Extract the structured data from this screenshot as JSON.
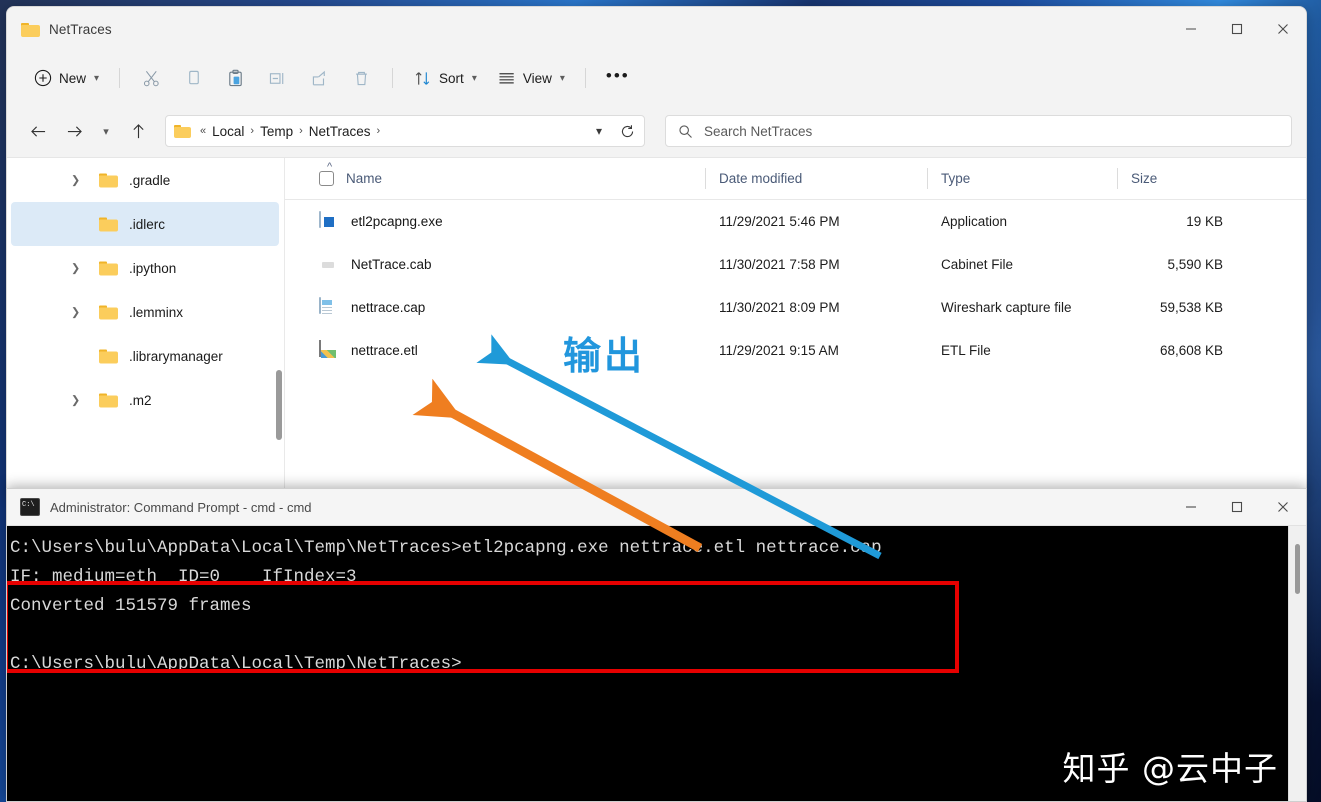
{
  "window": {
    "title": "NetTraces",
    "controls": {
      "minimize": "minimize-icon",
      "maximize": "maximize-icon",
      "close": "close-icon"
    }
  },
  "toolbar": {
    "new_label": "New",
    "cut_icon": "scissors-icon",
    "copy_icon": "copy-icon",
    "paste_icon": "paste-icon",
    "rename_icon": "rename-icon",
    "share_icon": "share-icon",
    "delete_icon": "trash-icon",
    "sort_label": "Sort",
    "view_label": "View",
    "overflow_label": "•••"
  },
  "nav": {
    "back_icon": "back-arrow-icon",
    "forward_icon": "forward-arrow-icon",
    "recent_icon": "chevron-down-icon",
    "up_icon": "up-arrow-icon",
    "refresh_icon": "refresh-icon",
    "breadcrumb_prefix": "«",
    "breadcrumbs": [
      "Local",
      "Temp",
      "NetTraces"
    ],
    "separator": "›"
  },
  "search": {
    "placeholder": "Search NetTraces",
    "icon": "search-icon"
  },
  "sidebar": {
    "items": [
      {
        "label": ".gradle",
        "expandable": true,
        "selected": false
      },
      {
        "label": ".idlerc",
        "expandable": false,
        "selected": true
      },
      {
        "label": ".ipython",
        "expandable": true,
        "selected": false
      },
      {
        "label": ".lemminx",
        "expandable": true,
        "selected": false
      },
      {
        "label": ".librarymanager",
        "expandable": false,
        "selected": false
      },
      {
        "label": ".m2",
        "expandable": true,
        "selected": false
      }
    ]
  },
  "filelist": {
    "columns": {
      "name": "Name",
      "date_modified": "Date modified",
      "type": "Type",
      "size": "Size"
    },
    "sort_indicator": "^",
    "rows": [
      {
        "name": "etl2pcapng.exe",
        "date_modified": "11/29/2021 5:46 PM",
        "type": "Application",
        "size": "19 KB",
        "icon": "application-exe-icon"
      },
      {
        "name": "NetTrace.cab",
        "date_modified": "11/30/2021 7:58 PM",
        "type": "Cabinet File",
        "size": "5,590 KB",
        "icon": "cabinet-file-icon"
      },
      {
        "name": "nettrace.cap",
        "date_modified": "11/30/2021 8:09 PM",
        "type": "Wireshark capture file",
        "size": "59,538 KB",
        "icon": "capture-file-icon"
      },
      {
        "name": "nettrace.etl",
        "date_modified": "11/29/2021 9:15 AM",
        "type": "ETL File",
        "size": "68,608 KB",
        "icon": "etl-file-icon"
      }
    ]
  },
  "annotations": {
    "output_label": "输出",
    "blue_arrow_color": "#1f9ad8",
    "orange_arrow_color": "#ef7e20",
    "red_box_color": "#e60000"
  },
  "console": {
    "title": "Administrator: Command Prompt - cmd - cmd",
    "icon": "command-prompt-icon",
    "controls": {
      "minimize": "minimize-icon",
      "maximize": "maximize-icon",
      "close": "close-icon"
    },
    "lines": [
      "C:\\Users\\bulu\\AppData\\Local\\Temp\\NetTraces>etl2pcapng.exe nettrace.etl nettrace.cap",
      "IF: medium=eth  ID=0    IfIndex=3",
      "Converted 151579 frames"
    ],
    "prompt_line": "C:\\Users\\bulu\\AppData\\Local\\Temp\\NetTraces>"
  },
  "watermark": {
    "text": "知乎 @云中子"
  }
}
